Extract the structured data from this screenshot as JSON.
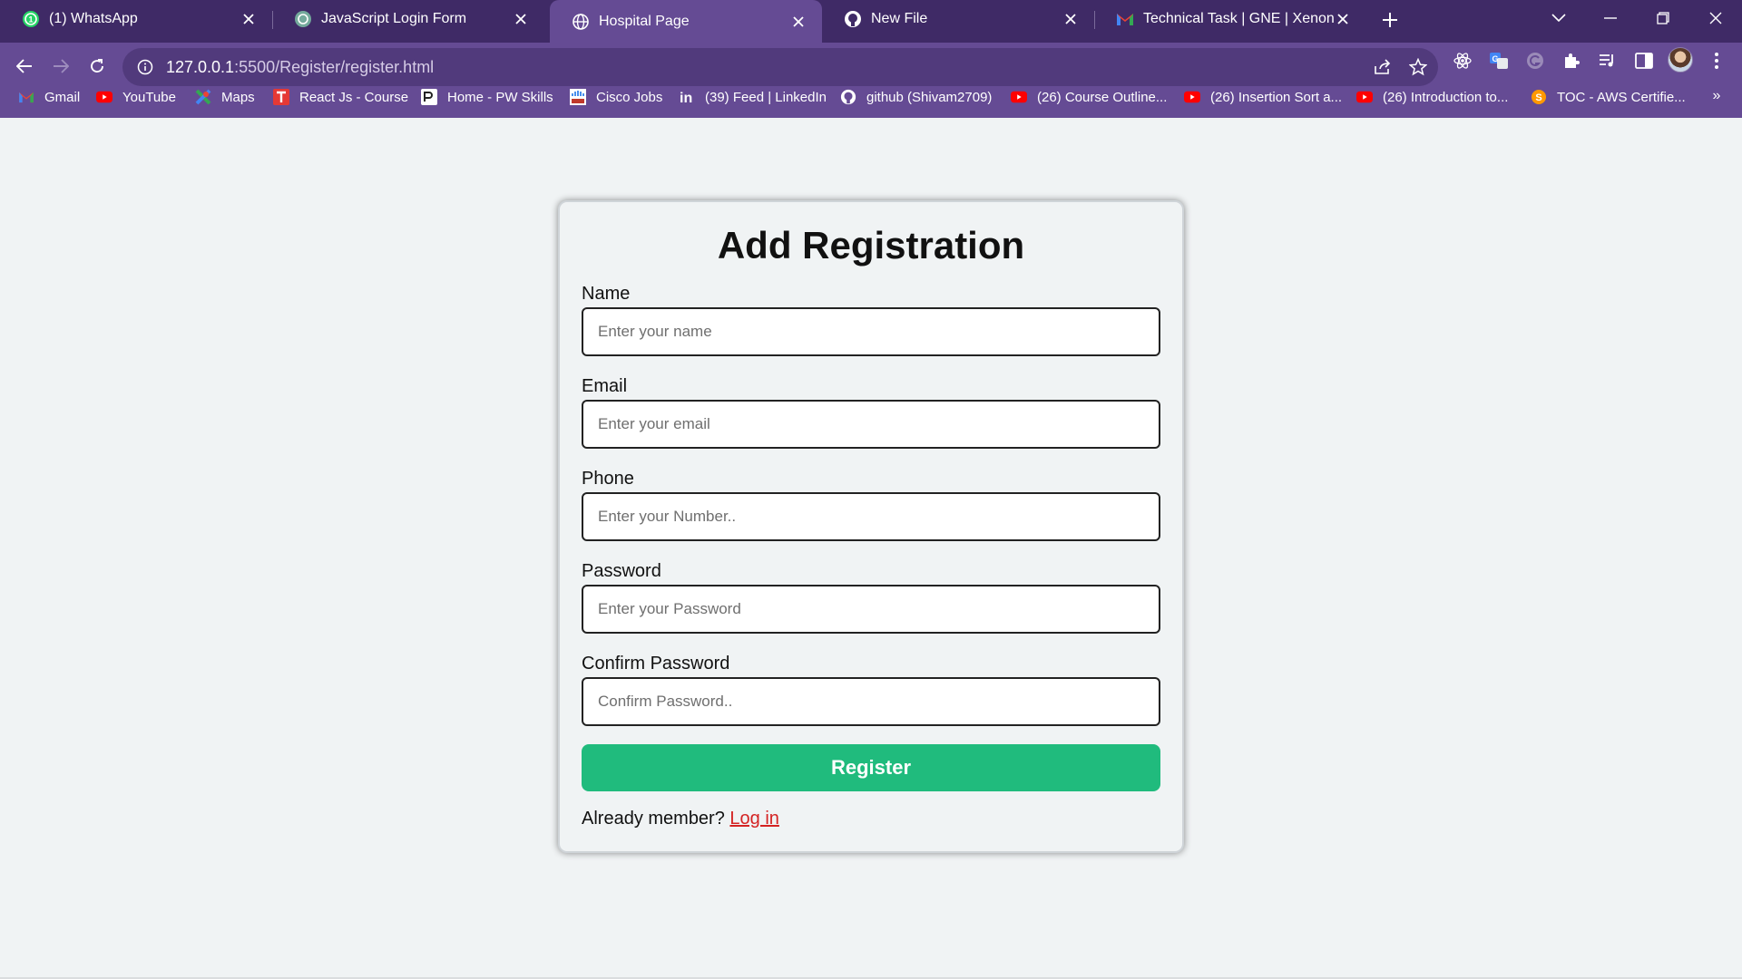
{
  "browser": {
    "tabs": [
      {
        "title": "(1) WhatsApp",
        "icon": "whatsapp-icon"
      },
      {
        "title": "JavaScript Login Form",
        "icon": "chatgpt-icon"
      },
      {
        "title": "Hospital Page",
        "icon": "globe-icon",
        "active": true
      },
      {
        "title": "New File",
        "icon": "github-icon"
      },
      {
        "title": "Technical Task | GNE | XenonStack",
        "icon": "gmail-icon"
      }
    ],
    "url_host": "127.0.0.1",
    "url_path": ":5500/Register/register.html",
    "bookmarks": [
      {
        "label": "Gmail",
        "icon": "gmail-icon"
      },
      {
        "label": "YouTube",
        "icon": "youtube-icon"
      },
      {
        "label": "Maps",
        "icon": "maps-icon"
      },
      {
        "label": "React Js - Course",
        "icon": "course-icon"
      },
      {
        "label": "Home - PW Skills",
        "icon": "pw-icon"
      },
      {
        "label": "Cisco Jobs",
        "icon": "cisco-icon"
      },
      {
        "label": "(39) Feed | LinkedIn",
        "icon": "linkedin-icon"
      },
      {
        "label": "github (Shivam2709)",
        "icon": "github-icon"
      },
      {
        "label": "(26) Course Outline...",
        "icon": "youtube-icon"
      },
      {
        "label": "(26) Insertion Sort a...",
        "icon": "youtube-icon"
      },
      {
        "label": "(26) Introduction to...",
        "icon": "youtube-icon"
      },
      {
        "label": "TOC - AWS Certifie...",
        "icon": "aws-icon"
      }
    ],
    "bookmarks_overflow": "»"
  },
  "form": {
    "title": "Add Registration",
    "fields": [
      {
        "label": "Name",
        "placeholder": "Enter your name",
        "value": ""
      },
      {
        "label": "Email",
        "placeholder": "Enter your email",
        "value": ""
      },
      {
        "label": "Phone",
        "placeholder": "Enter your Number..",
        "value": ""
      },
      {
        "label": "Password",
        "placeholder": "Enter your Password",
        "value": ""
      },
      {
        "label": "Confirm Password",
        "placeholder": "Confirm Password..",
        "value": ""
      }
    ],
    "submit_label": "Register",
    "footer_text": "Already member?",
    "login_link": "Log in"
  },
  "colors": {
    "tabbar": "#3f2a66",
    "toolbar": "#654b94",
    "button": "#20bb7d",
    "link": "#d42222",
    "page_bg": "#f0f3f4"
  }
}
